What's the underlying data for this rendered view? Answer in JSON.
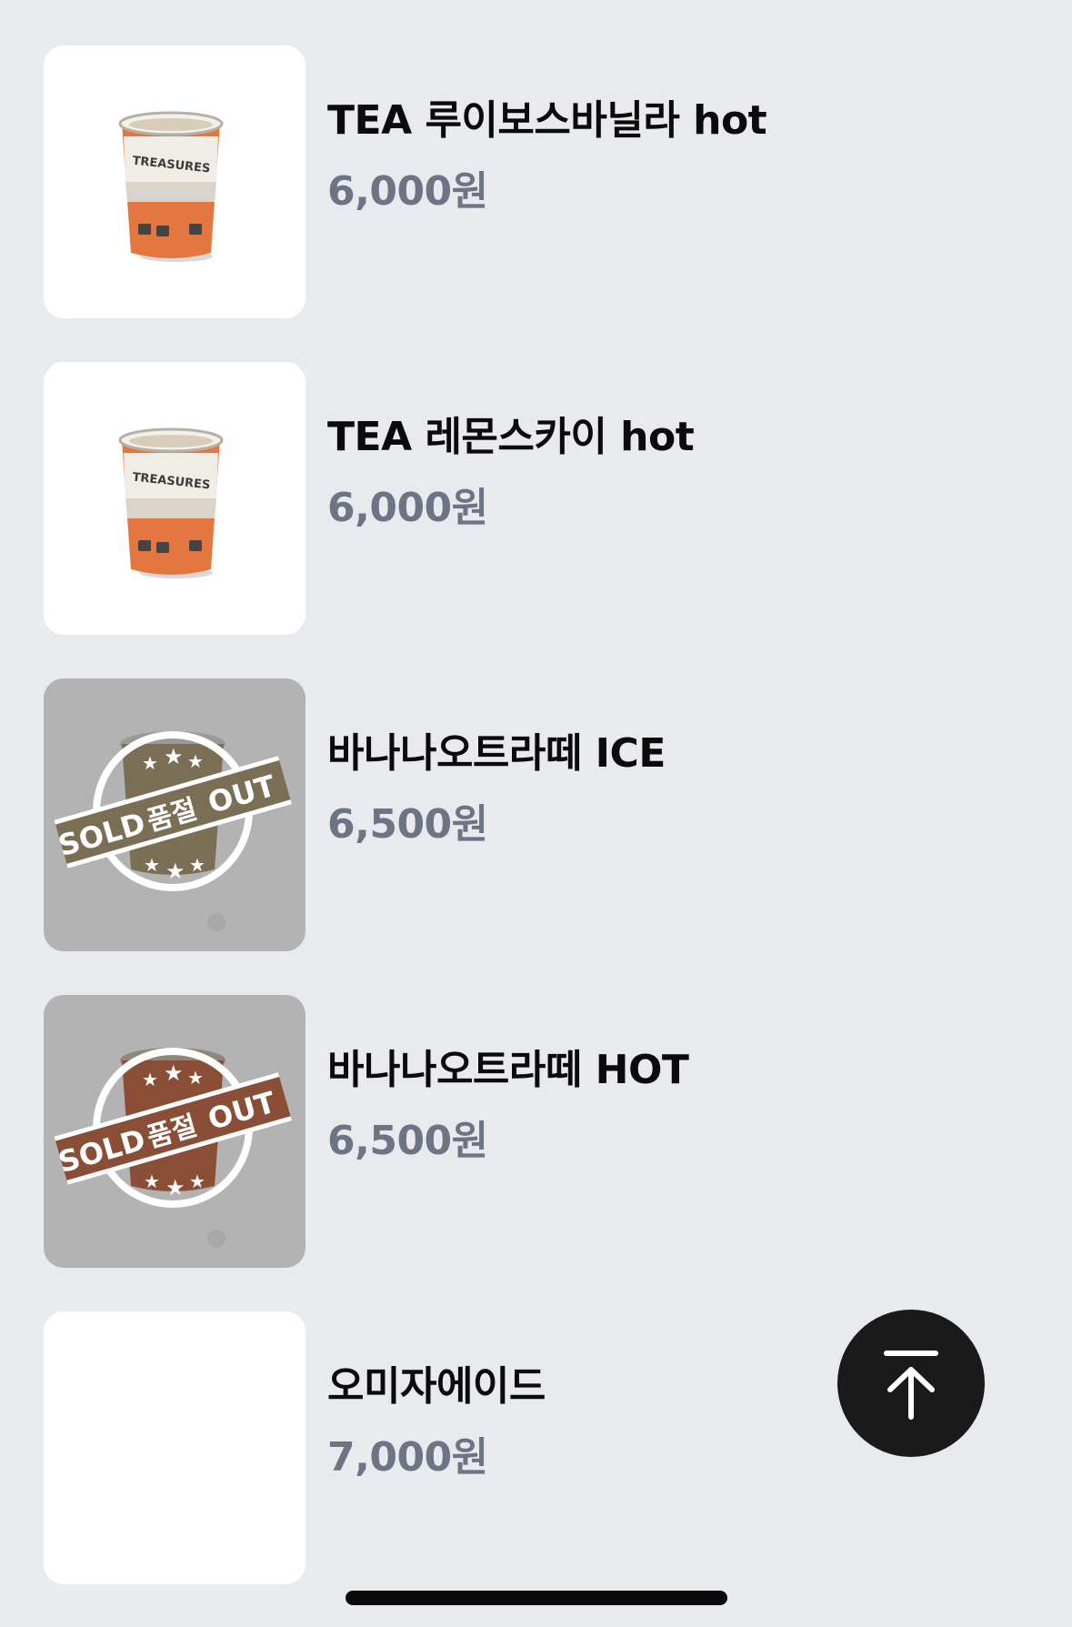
{
  "menu": {
    "items": [
      {
        "name": "TEA 루이보스바닐라 hot",
        "price": "6,000원",
        "image": "tea-cup",
        "sold_out": false
      },
      {
        "name": "TEA 레몬스카이 hot",
        "price": "6,000원",
        "image": "tea-cup",
        "sold_out": false
      },
      {
        "name": "바나나오트라떼 ICE",
        "price": "6,500원",
        "image": "latte-cup",
        "sold_out": true
      },
      {
        "name": "바나나오트라떼 HOT",
        "price": "6,500원",
        "image": "latte-cup",
        "sold_out": true
      },
      {
        "name": "오미자에이드",
        "price": "7,000원",
        "image": "none",
        "sold_out": false
      }
    ]
  },
  "cup_print": "TREASURES",
  "sold_out_stamp": {
    "left": "SOLD",
    "middle": "품절",
    "right": "OUT"
  },
  "scroll_top_button": {
    "icon": "arrow-up-to-line-icon"
  },
  "colors": {
    "background": "#e9eaee",
    "name_text": "#0b0b0b",
    "price_text": "#6f7484",
    "soldout_overlay": "#b3b3b3",
    "fab": "#1a1a1a"
  }
}
